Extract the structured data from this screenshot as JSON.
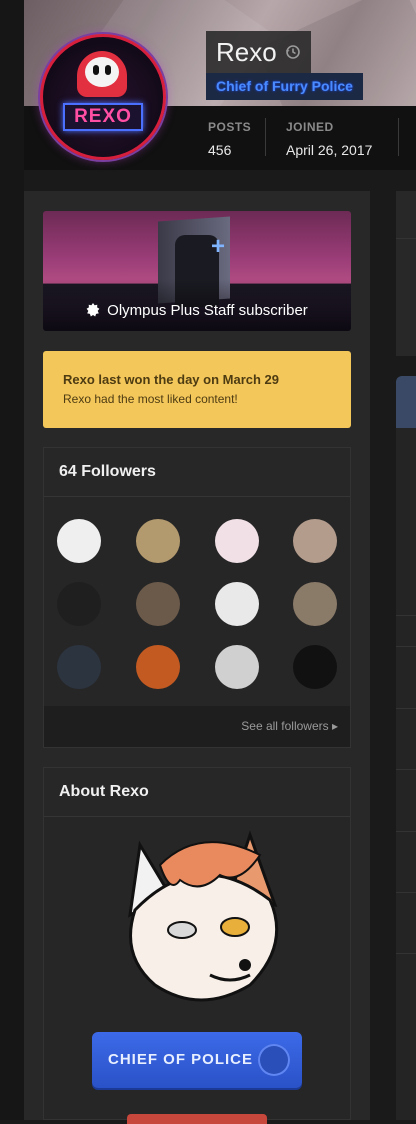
{
  "profile": {
    "name": "Rexo",
    "title": "Chief of Furry Police",
    "avatar_text": "REXO",
    "stats": [
      {
        "label": "POSTS",
        "value": "456"
      },
      {
        "label": "JOINED",
        "value": "April 26, 2017"
      }
    ]
  },
  "subscription": {
    "label": "Olympus Plus Staff subscriber"
  },
  "won_day": {
    "line1": "Rexo last won the day on March 29",
    "line2": "Rexo had the most liked content!"
  },
  "followers": {
    "title": "64 Followers",
    "see_all": "See all followers ▸",
    "avatars": [
      "#efefef",
      "#b39a6e",
      "#f1e1e6",
      "#b49c8d",
      "#1f1f1f",
      "#6b5a4a",
      "#e9e9e9",
      "#8a7a68",
      "#2c3440",
      "#c35a22",
      "#d0d0d0",
      "#111111"
    ]
  },
  "about": {
    "title": "About Rexo",
    "police_label": "CHIEF OF POLICE"
  },
  "colors": {
    "accent_blue": "#4a8bff",
    "won_yellow": "#f4c75a"
  }
}
